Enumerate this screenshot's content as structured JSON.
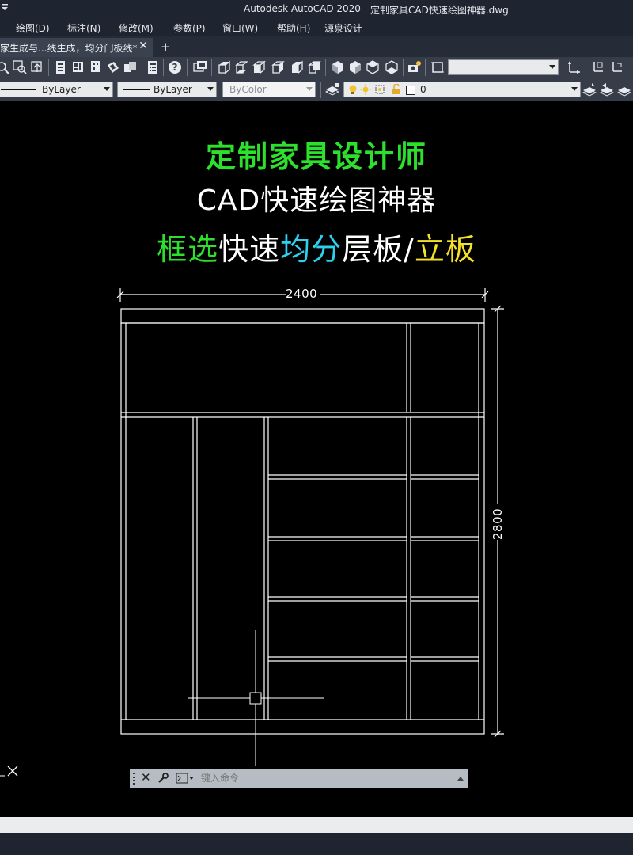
{
  "window": {
    "app_title": "Autodesk AutoCAD 2020",
    "doc_title": "定制家具CAD快速绘图神器.dwg"
  },
  "menu": [
    "绘图(D)",
    "标注(N)",
    "修改(M)",
    "参数(P)",
    "窗口(W)",
    "帮助(H)",
    "源泉设计"
  ],
  "tab": {
    "label": "家生成与...线生成，均分门板线*",
    "close": "✕",
    "new_tab": "+"
  },
  "properties": {
    "linetype": "ByLayer",
    "lineweight": "ByLayer",
    "color": "ByColor",
    "layer": "0"
  },
  "banner": {
    "line1": "定制家具设计师",
    "line2": "CAD快速绘图神器",
    "line3": [
      {
        "text": "框选",
        "color": "#2de02d"
      },
      {
        "text": "快速",
        "color": "#ffffff"
      },
      {
        "text": "均分",
        "color": "#2fd0ee"
      },
      {
        "text": "层板/",
        "color": "#ffffff"
      },
      {
        "text": "立板",
        "color": "#f5e12b"
      }
    ]
  },
  "drawing": {
    "width_dim": "2400",
    "height_dim": "2800"
  },
  "command_line": {
    "placeholder": "键入命令"
  },
  "colors": {
    "title_bg": "#1f2530",
    "toolbar_bg": "#363d49",
    "canvas_bg": "#000000",
    "accent_green": "#2de02d",
    "accent_cyan": "#2fd0ee",
    "accent_yellow": "#f5e12b"
  }
}
